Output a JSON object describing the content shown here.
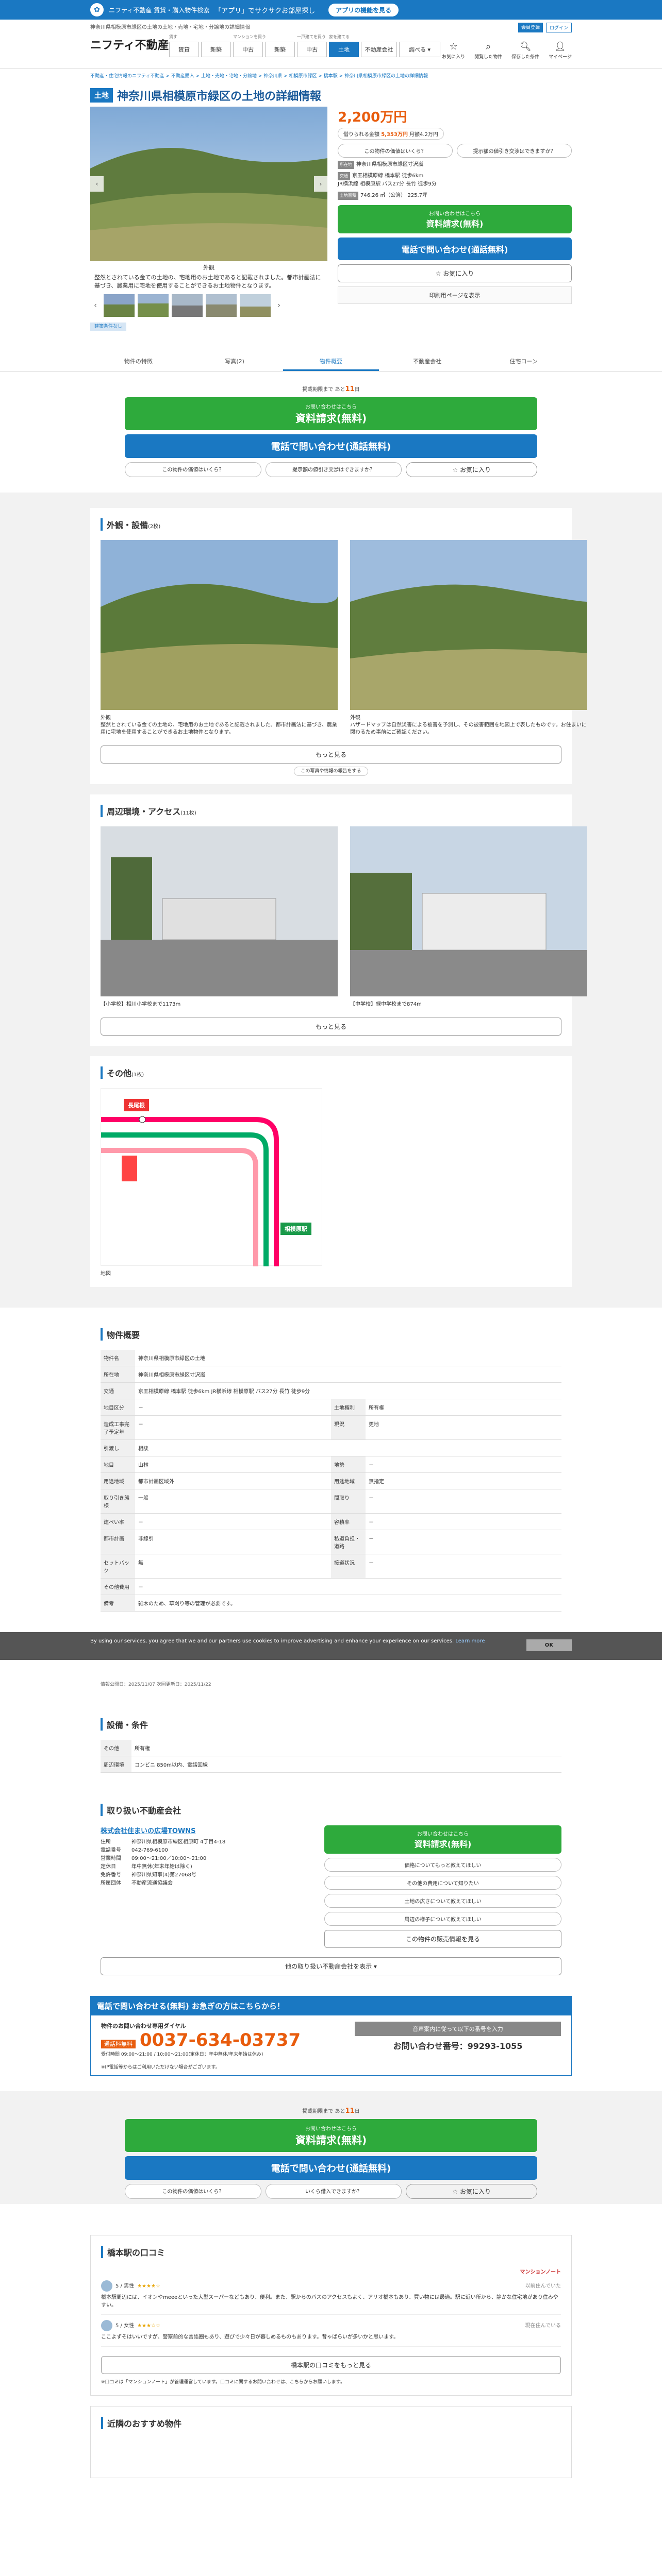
{
  "topbar": {
    "brand": "ニフティ不動産 賃貸・購入物件検索",
    "promo": "「アプリ」でサクサクお部屋探し",
    "app_button": "アプリの機能を見る"
  },
  "header": {
    "tagline": "神奈川県相模原市緑区の土地の土地・売地・宅地・分譲地の詳細情報",
    "links": [
      "会員登録",
      "ログイン"
    ],
    "brand": "ニフティ不動産",
    "search_groups": [
      {
        "label": "賃す",
        "items": [
          "賃貸",
          "新築"
        ]
      },
      {
        "label": "マンションを買う",
        "items": [
          "中古",
          "新築"
        ]
      },
      {
        "label": "一戸建てを買う",
        "items": [
          "中古",
          "新築"
        ]
      },
      {
        "label": "家を建てる",
        "items": [
          "土地"
        ]
      }
    ],
    "extras": [
      "不動産会社",
      "調べる ▾"
    ],
    "icons": [
      {
        "glyph": "☆",
        "label": "お気に入り"
      },
      {
        "glyph": "⌕",
        "label": "閲覧した物件"
      },
      {
        "glyph": "🔍︎",
        "label": "保存した条件"
      },
      {
        "glyph": "👤︎",
        "label": "マイページ"
      }
    ]
  },
  "breadcrumbs": "不動産・住宅情報のニフティ不動産 > 不動産購入 > 土地・売地・宅地・分譲地 > 神奈川県 > 相模原市緑区 > 橋本駅 > 神奈川県相模原市緑区の土地の詳細情報",
  "title": {
    "tag": "土地",
    "text": "神奈川県相模原市緑区の土地の詳細情報"
  },
  "gallery": {
    "caption_title": "外観",
    "caption": "整然とされている金ての土地の、宅地用のお土地であると記載されました。都市計画法に基づき、農業用に宅地を使用することができるお土地物件となります。",
    "thumb_count": 5
  },
  "summary": {
    "price": "2,200万円",
    "loan_label": "借りられる金額",
    "loan_value": "5,353万円",
    "loan_extra": "月額4.2万円",
    "checks": [
      "この物件の価値はいくら？",
      "提示額の値引き交渉はできますか？"
    ],
    "address_label": "所在地",
    "address": "神奈川県相模原市緑区寸沢嵐",
    "access_label": "交通",
    "access": "京王相模原線 橋本駅 徒歩6km",
    "access2": "JR横浜線 相模原駅 バス27分 長竹 徒歩9分",
    "area_label": "土地面積",
    "area": "746.26 ㎡（公簿）",
    "area2": "225.7坪",
    "buttons": {
      "request": "お問い合わせはこちら",
      "request_main": "資料請求(無料)",
      "phone": "電話で問い合わせ(通話無料)",
      "fav": "☆ お気に入り",
      "print": "印刷用ページを表示"
    }
  },
  "badge": "建築条件なし",
  "tabs": [
    "物件の特徴",
    "写真(2)",
    "物件概要",
    "不動産会社",
    "住宅ローン"
  ],
  "cta": {
    "deadline_prefix": "掲載期限まで あと",
    "deadline_days": "11",
    "deadline_suffix": "日",
    "request_sub": "お問い合わせはこちら",
    "request": "資料請求(無料)",
    "phone": "電話で問い合わせ(通話無料)",
    "checks": [
      "この物件の価値はいくら？",
      "提示額の値引き交渉はできますか？"
    ],
    "fav": "☆ お気に入り"
  },
  "exterior": {
    "title": "外観・設備",
    "count": "(2枚)",
    "photos": [
      {
        "cap_title": "外観",
        "cap": "整然とされている金ての土地の、宅地用のお土地であると記載されました。都市計画法に基づき、農業用に宅地を使用することができるお土地物件となります。"
      },
      {
        "cap_title": "外観",
        "cap": "ハザードマップは自然災害による被害を予測し、その被害範囲を地図上で表したものです。お住まいに関わるため事前にご確認ください。"
      }
    ],
    "more": "もっと見る",
    "report": "この写真や情報の報告をする"
  },
  "surroundings": {
    "title": "周辺環境・アクセス",
    "count": "(11枚)",
    "photos": [
      {
        "cap": "【小学校】相川小学校まで1173m"
      },
      {
        "cap": "【中学校】緑中学校まで874m"
      }
    ],
    "more": "もっと見る"
  },
  "other": {
    "title": "その他",
    "count": "(1枚)",
    "cap": "地図",
    "map_labels": {
      "a": "長尾根",
      "b": "相模原駅",
      "c": "橋本駅"
    }
  },
  "overview": {
    "title": "物件概要",
    "rows": [
      [
        "物件名",
        "神奈川県相模原市緑区の土地",
        "",
        ""
      ],
      [
        "所在地",
        "神奈川県相模原市緑区寸沢嵐",
        "",
        ""
      ],
      [
        "交通",
        "京王相模原線 橋本駅 徒歩6km JR横浜線 相模原駅 バス27分 長竹 徒歩9分",
        "",
        ""
      ],
      [
        "地目区分",
        "－",
        "土地権利",
        "所有権"
      ],
      [
        "造成工事完了予定年",
        "－",
        "現況",
        "更地"
      ],
      [
        "引渡し",
        "相談",
        "",
        ""
      ],
      [
        "地目",
        "山林",
        "地勢",
        "－"
      ],
      [
        "用途地域",
        "都市計画区域外",
        "用途地域",
        "無指定"
      ],
      [
        "取り引き態様",
        "一般",
        "間取り",
        "－"
      ],
      [
        "建ぺい率",
        "－",
        "容積率",
        "－"
      ],
      [
        "都市計画",
        "非線引",
        "私道負担・道路",
        "－"
      ],
      [
        "セットバック",
        "無",
        "接道状況",
        "－"
      ],
      [
        "その他費用",
        "－",
        "",
        ""
      ],
      [
        "備考",
        "雑木のため、草刈り等の管理が必要です。",
        "",
        ""
      ]
    ],
    "update": "情報公開日：2025/11/07 次回更新日：2025/11/22"
  },
  "facilities": {
    "title": "設備・条件",
    "rows": [
      [
        "その他",
        "所有権"
      ],
      [
        "周辺環境",
        "コンビニ 850m以内、電話回線"
      ]
    ]
  },
  "cookie": {
    "text": "By using our services, you agree that we and our partners use cookies to improve advertising and enhance your experience on our services.",
    "link": "Learn more",
    "ok": "OK"
  },
  "company": {
    "title": "取り扱い不動産会社",
    "name": "株式会社住まいの広場TOWNS",
    "rows": [
      [
        "住所",
        "神奈川県相模原市緑区相原町 4丁目4-18"
      ],
      [
        "電話番号",
        "042-769-6100"
      ],
      [
        "営業時間",
        "09:00〜21:00／10:00〜21:00"
      ],
      [
        "定休日",
        "年中無休(年末年始は除く)"
      ],
      [
        "免許番号",
        "神奈川県知事(4)第27068号"
      ],
      [
        "所属団体",
        "不動産流通協議会"
      ]
    ],
    "buttons": [
      "お問い合わせはこちら",
      "資料請求(無料)",
      "この物件の販売情報を見る"
    ],
    "checks": [
      "価格についてもっと教えてほしい",
      "その他の費用について知りたい",
      "土地の広さについて教えてほしい",
      "周辺の様子について教えてほしい"
    ],
    "more": "他の取り扱い不動産会社を表示 ▾"
  },
  "phone": {
    "header": "電話で問い合わせる(無料) お急ぎの方はこちらから！",
    "label": "物件のお問い合わせ専用ダイヤル",
    "free": "通話料無料",
    "number": "0037-634-03737",
    "hours": "受付時間 09:00〜21:00 / 10:00〜21:00(定休日：年中無休/年末年始は休み)",
    "hint": "音声案内に従って以下の番号を入力",
    "code_label": "お問い合わせ番号：",
    "code": "99293-1055",
    "notes": "※IP電話等からはご利用いただけない場合がございます。"
  },
  "cta2": {
    "deadline_prefix": "掲載期限まで あと",
    "deadline_days": "11",
    "deadline_suffix": "日",
    "request_sub": "お問い合わせはこちら",
    "request": "資料請求(無料)",
    "phone": "電話で問い合わせ(通話無料)",
    "checks": [
      "この物件の価値はいくら？",
      "いくら借入できますか？"
    ],
    "fav": "☆ お気に入り"
  },
  "reviews": {
    "title": "橋本駅の口コミ",
    "powered": "マンションノート",
    "items": [
      {
        "who": "5 / 男性",
        "when": "以前住んでいた",
        "text": "橋本駅周辺には、イオンやmeeeといった大型スーパーなどもあり、便利。また、駅からのバスのアクセスもよく、アリオ橋本もあり、買い物には最適。駅に近い所から、静かな住宅地があり住みやすい。"
      },
      {
        "who": "5 / 女性",
        "when": "現在住んでいる",
        "text": "ここよずそはいいですが、警察前的な言語圏もあり、遊びで少々日が暮しめるものもあります。昔ゃばらいが多いかと思います。"
      }
    ],
    "more": "橋本駅の口コミをもっと見る",
    "note": "※口コミは「マンションノート」が管理運営しています。口コミに関するお問い合わせは、こちらからお願いします。"
  },
  "recommend": {
    "title": "近隣のおすすめ物件"
  }
}
